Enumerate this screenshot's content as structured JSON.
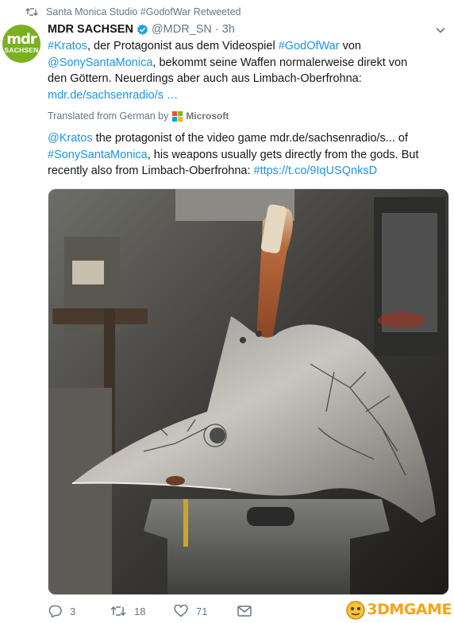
{
  "retweet_header": {
    "text": "Santa Monica Studio #GodofWar Retweeted",
    "icon": "retweet-icon"
  },
  "avatar": {
    "logo_text": "mdr",
    "sub_text": "SACHSEN",
    "color": "#7bb01f"
  },
  "author": {
    "name": "MDR SACHSEN",
    "verified": true,
    "handle": "@MDR_SN",
    "separator": "·",
    "time": "3h"
  },
  "tweet": {
    "segments": [
      {
        "text": "#Kratos",
        "link": true
      },
      {
        "text": ", der Protagonist aus dem Videospiel ",
        "link": false
      },
      {
        "text": "#GodOfWar",
        "link": true
      },
      {
        "text": " von ",
        "link": false
      },
      {
        "text": "@SonySantaMonica",
        "link": true
      },
      {
        "text": ", bekommt seine Waffen normalerweise direkt von den Göttern. Neuerdings aber auch aus Limbach-Oberfrohna: ",
        "link": false
      },
      {
        "text": "mdr.de/sachsenradio/s …",
        "link": true
      }
    ]
  },
  "translation_label": {
    "text": "Translated from German by",
    "brand": "Microsoft"
  },
  "translation": {
    "segments": [
      {
        "text": "@Kratos",
        "link": true
      },
      {
        "text": " the protagonist of the video game mdr.de/sachsenradio/s... of ",
        "link": false
      },
      {
        "text": "#SonySantaMonica",
        "link": true
      },
      {
        "text": ", his weapons usually gets directly from the gods. But recently also from Limbach-Oberfrohna: ",
        "link": false
      },
      {
        "text": "#ttps://t.co/9IqUSQnksD",
        "link": true
      }
    ]
  },
  "media": {
    "alt": "Leviathan axe replica on an anvil in a forge",
    "icon": "photo"
  },
  "actions": {
    "reply": {
      "icon": "reply-icon",
      "count": "3"
    },
    "retweet": {
      "icon": "retweet-icon",
      "count": "18"
    },
    "like": {
      "icon": "heart-icon",
      "count": "71"
    },
    "dm": {
      "icon": "envelope-icon"
    }
  },
  "watermark": {
    "text": "3DMGAME"
  },
  "colors": {
    "link": "#1b95e0",
    "muted": "#657786",
    "text": "#14171a",
    "verified": "#1da1f2"
  }
}
